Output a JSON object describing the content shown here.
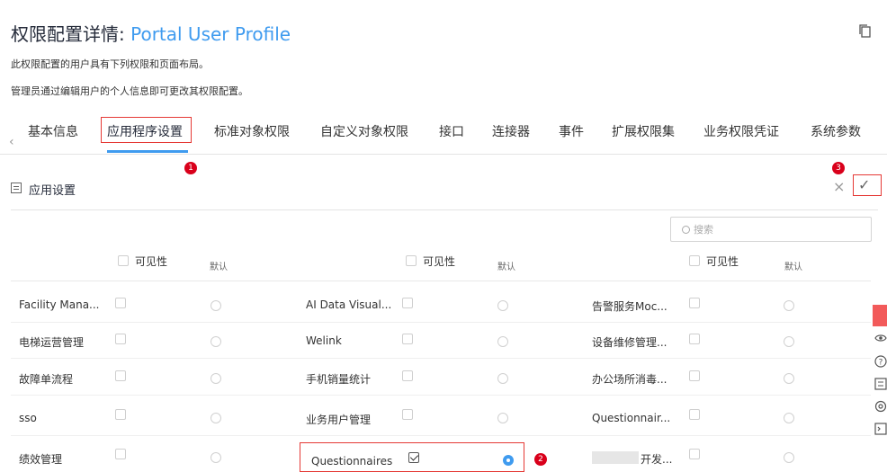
{
  "page": {
    "title_prefix": "权限配置详情: ",
    "title_name": "Portal User Profile",
    "desc1": "此权限配置的用户具有下列权限和页面布局。",
    "desc2": "管理员通过编辑用户的个人信息即可更改其权限配置。"
  },
  "tabs": [
    "基本信息",
    "应用程序设置",
    "标准对象权限",
    "自定义对象权限",
    "接口",
    "连接器",
    "事件",
    "扩展权限集",
    "业务权限凭证",
    "系统参数"
  ],
  "tabs_prev": "‹",
  "markers": [
    "1",
    "2",
    "3"
  ],
  "section": {
    "title": "应用设置",
    "close": "×",
    "confirm": "✓",
    "search_placeholder": "搜索"
  },
  "columns": {
    "visibility": "可见性",
    "default": "默认"
  },
  "rows": [
    [
      "Facility Mana...",
      "AI Data Visual...",
      "告警服务Moc..."
    ],
    [
      "电梯运营管理",
      "Welink",
      "设备维修管理..."
    ],
    [
      "故障单流程",
      "手机销量统计",
      "办公场所消毒..."
    ],
    [
      "sso",
      "业务用户管理",
      "Questionnair..."
    ],
    [
      "绩效管理",
      "Questionnaires",
      "开发..."
    ]
  ],
  "toolbar_icons": [
    "chat-icon",
    "eye-icon",
    "help-icon",
    "list-icon",
    "settings-icon",
    "terminal-icon"
  ]
}
